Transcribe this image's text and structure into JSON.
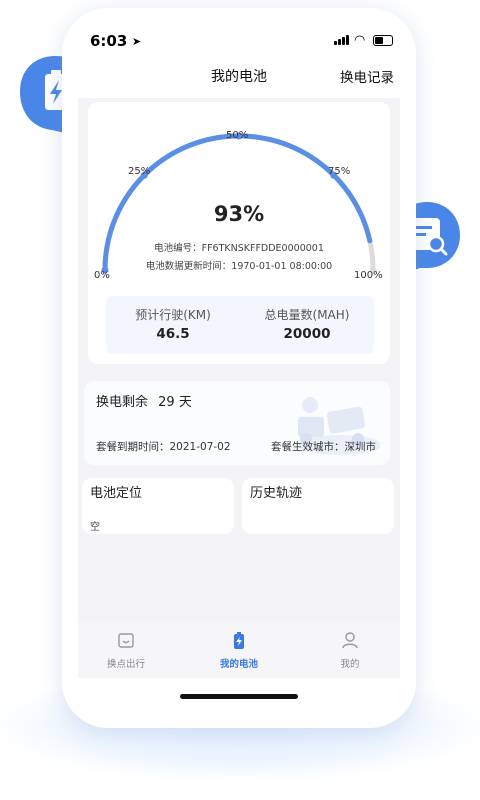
{
  "status": {
    "time": "6:03"
  },
  "header": {
    "title": "我的电池",
    "action": "换电记录"
  },
  "gauge": {
    "value_text": "93%",
    "level": 0.93,
    "ticks": [
      "0%",
      "25%",
      "50%",
      "75%",
      "100%"
    ],
    "serial_line": "电池编号：FF6TKNSKFFDDE0000001",
    "update_line": "电池数据更新时间：1970-01-01 08:00:00",
    "colors": {
      "arc": "#5b8fe6",
      "track": "#dcdcdc"
    }
  },
  "stats": [
    {
      "label": "预计行驶(KM)",
      "value": "46.5"
    },
    {
      "label": "总电量数(MAH)",
      "value": "20000"
    }
  ],
  "exchange": {
    "remain_label": "换电剩余",
    "remain_value": "29 天",
    "expire": "套餐到期时间：2021-07-02",
    "city": "套餐生效城市：深圳市"
  },
  "cards": {
    "location": {
      "title": "电池定位",
      "value": "空"
    },
    "track": {
      "title": "历史轨迹"
    }
  },
  "tabs": [
    {
      "label": "换点出行",
      "icon": "store-icon"
    },
    {
      "label": "我的电池",
      "icon": "battery-icon"
    },
    {
      "label": "我的",
      "icon": "user-icon"
    }
  ],
  "theme": {
    "accent": "#4a86e8"
  }
}
